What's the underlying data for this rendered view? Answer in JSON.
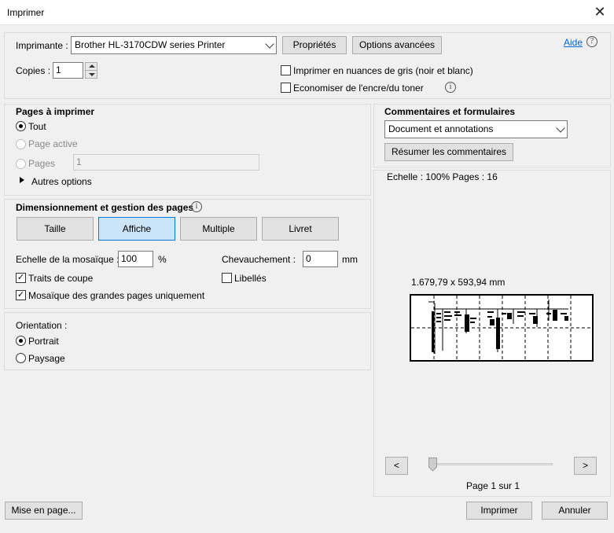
{
  "window": {
    "title": "Imprimer"
  },
  "printer": {
    "label": "Imprimante :",
    "selected": "Brother HL-3170CDW series Printer",
    "properties_label": "Propriétés",
    "advanced_label": "Options avancées",
    "help_label": "Aide"
  },
  "copies": {
    "label": "Copies :",
    "value": "1"
  },
  "options": {
    "grayscale": {
      "label": "Imprimer en nuances de gris (noir et blanc)",
      "checked": false
    },
    "save_ink": {
      "label": "Economiser de l'encre/du toner",
      "checked": false
    }
  },
  "pages": {
    "heading": "Pages à imprimer",
    "all_label": "Tout",
    "current_label": "Page active",
    "range_label": "Pages",
    "range_value": "1",
    "more_label": "Autres options"
  },
  "comments": {
    "heading": "Commentaires et formulaires",
    "selected": "Document et annotations",
    "summarize_label": "Résumer les commentaires"
  },
  "sizing": {
    "heading": "Dimensionnement et gestion des pages",
    "tabs": [
      "Taille",
      "Affiche",
      "Multiple",
      "Livret"
    ],
    "active_tab": "Affiche",
    "tile_scale_label": "Echelle de la mosaïque :",
    "tile_scale_value": "100",
    "tile_scale_unit": "%",
    "overlap_label": "Chevauchement :",
    "overlap_value": "0",
    "overlap_unit": "mm",
    "cut_marks_label": "Traits de coupe",
    "cut_marks_checked": true,
    "labels_label": "Libellés",
    "labels_checked": false,
    "large_only_label": "Mosaïque des grandes pages uniquement",
    "large_only_checked": true
  },
  "orientation": {
    "heading": "Orientation :",
    "portrait_label": "Portrait",
    "landscape_label": "Paysage",
    "selected": "Portrait"
  },
  "preview": {
    "scale_text": "Echelle : 100% Pages : 16",
    "dimensions": "1.679,79 x 593,94 mm",
    "prev_label": "<",
    "next_label": ">",
    "page_text": "Page 1 sur 1"
  },
  "footer": {
    "page_setup_label": "Mise en page...",
    "print_label": "Imprimer",
    "cancel_label": "Annuler"
  }
}
